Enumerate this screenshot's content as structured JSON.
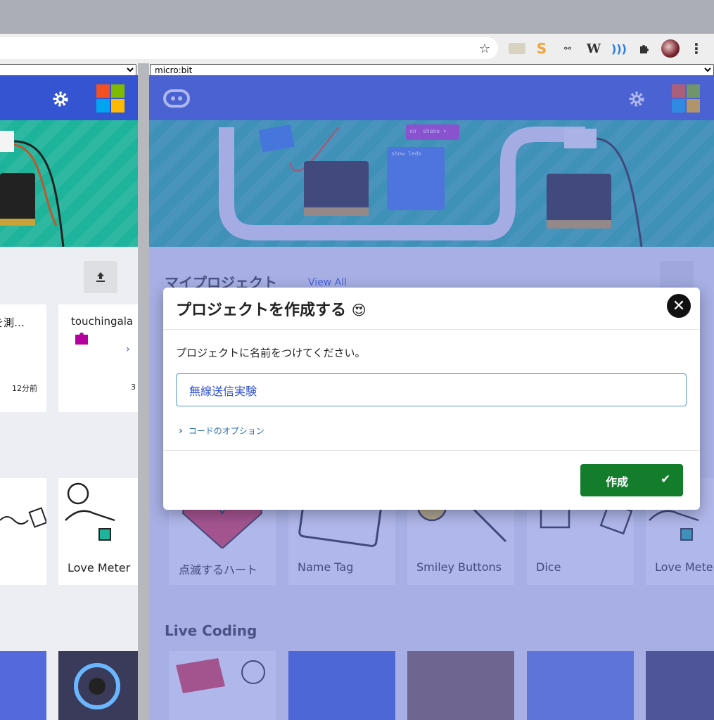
{
  "browser": {
    "star_icon": "star-icon",
    "extension_s_label": "S",
    "extension_w_label": "W",
    "menu_glyph": "⋮",
    "extensions_icon": "puzzle-icon"
  },
  "left_pane": {
    "settings_icon": "gear-icon",
    "upload_icon": "upload-icon",
    "project_card_1": {
      "title": "を測…",
      "time": "12分前"
    },
    "project_card_2": {
      "title": "touchingala",
      "time": "3"
    },
    "tutorial_card": {
      "title": "Love Meter"
    }
  },
  "right_pane": {
    "frame_select": {
      "value": "micro:bit"
    },
    "hero_block_on": "on",
    "hero_block_shake": "shake ▾",
    "hero_block_show_leds": "show leds",
    "my_projects": {
      "title": "マイプロジェクト",
      "view_all": "View All"
    },
    "tutorials": [
      {
        "title": "点滅するハート"
      },
      {
        "title": "Name Tag"
      },
      {
        "title": "Smiley Buttons"
      },
      {
        "title": "Dice"
      },
      {
        "title": "Love Mete"
      }
    ],
    "live_coding": {
      "title": "Live Coding"
    }
  },
  "dialog": {
    "title": "プロジェクトを作成する",
    "title_emoji": "😍",
    "prompt": "プロジェクトに名前をつけてください。",
    "name_value": "無線送信実験",
    "options_label": "コードのオプション",
    "create_label": "作成",
    "close_glyph": "✕"
  },
  "colors": {
    "header_blue": "#3454d1",
    "hero_teal": "#1eb39b",
    "create_green": "#137d2c",
    "overlay": "#6270d6"
  }
}
